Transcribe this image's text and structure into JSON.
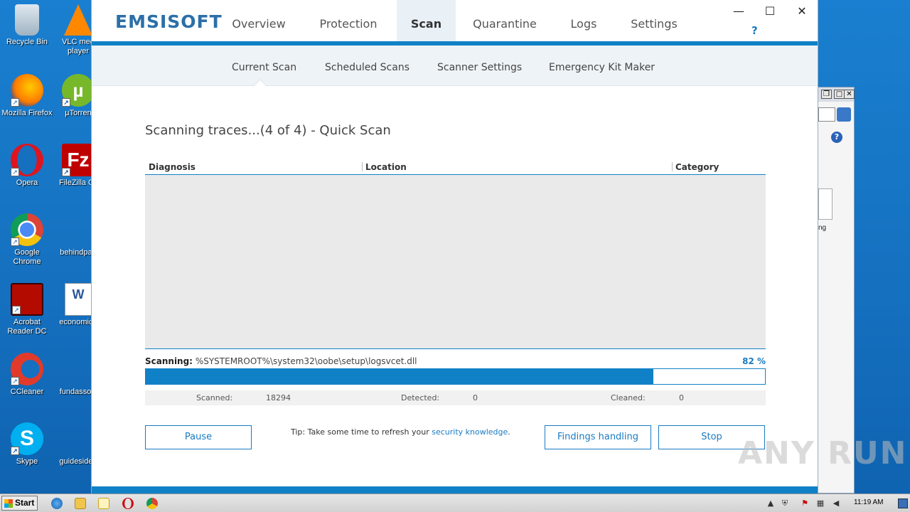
{
  "desktop": {
    "icons": [
      {
        "label": "Recycle Bin",
        "icon": "recycle-bin-icon"
      },
      {
        "label": "VLC med\nplayer",
        "icon": "vlc-icon"
      },
      {
        "label": "Mozilla Firefox",
        "icon": "firefox-icon"
      },
      {
        "label": "µTorren",
        "icon": "utorrent-icon"
      },
      {
        "label": "Opera",
        "icon": "opera-icon"
      },
      {
        "label": "FileZilla Cli",
        "icon": "filezilla-icon"
      },
      {
        "label": "Google\nChrome",
        "icon": "chrome-icon"
      },
      {
        "label": "behindpau",
        "icon": "file-icon"
      },
      {
        "label": "Acrobat\nReader DC",
        "icon": "acrobat-icon"
      },
      {
        "label": "economicg",
        "icon": "word-document-icon"
      },
      {
        "label": "CCleaner",
        "icon": "ccleaner-icon"
      },
      {
        "label": "fundassoci",
        "icon": "file-icon"
      },
      {
        "label": "Skype",
        "icon": "skype-icon"
      },
      {
        "label": "guidesidea",
        "icon": "file-icon"
      }
    ]
  },
  "bg_window": {
    "partial_text": "ng"
  },
  "app": {
    "logo": "EMSISOFT",
    "tabs": [
      "Overview",
      "Protection",
      "Scan",
      "Quarantine",
      "Logs",
      "Settings"
    ],
    "active_tab": "Scan",
    "help": "?",
    "subtabs": [
      "Current Scan",
      "Scheduled Scans",
      "Scanner Settings",
      "Emergency Kit Maker"
    ],
    "active_subtab": "Current Scan",
    "scan_title": "Scanning traces...(4 of 4) - Quick Scan",
    "columns": [
      "Diagnosis",
      "Location",
      "Category"
    ],
    "scanning_label": "Scanning:",
    "scanning_path": "%SYSTEMROOT%\\system32\\oobe\\setup\\logsvcet.dll",
    "progress_percent": 82,
    "progress_text": "82 %",
    "stats": {
      "scanned_label": "Scanned:",
      "scanned_value": "18294",
      "detected_label": "Detected:",
      "detected_value": "0",
      "cleaned_label": "Cleaned:",
      "cleaned_value": "0"
    },
    "buttons": {
      "pause": "Pause",
      "findings": "Findings handling",
      "stop": "Stop"
    },
    "tip_text": "Tip: Take some time to refresh your ",
    "tip_link": "security knowledge",
    "tip_end": "."
  },
  "watermark": "ANY RUN",
  "taskbar": {
    "start": "Start",
    "clock": "11:19 AM"
  },
  "colors": {
    "accent": "#1181c7",
    "desktop": "#1476c4"
  }
}
